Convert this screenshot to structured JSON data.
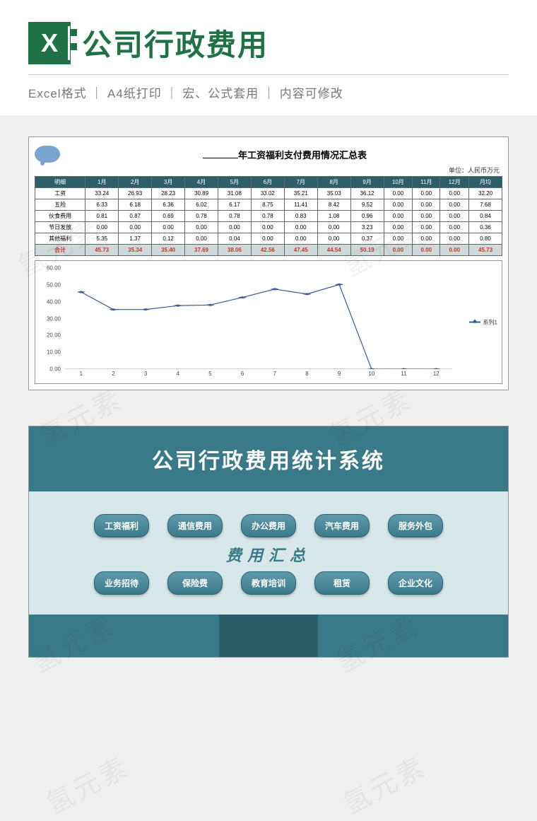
{
  "header": {
    "title": "公司行政费用",
    "subtitle": "Excel格式 ｜ A4纸打印 ｜ 宏、公式套用 ｜ 内容可修改"
  },
  "sheet1": {
    "title_prefix": "",
    "title_core": "年工资福利支付费用情况汇总表",
    "unit": "单位：人民币万元",
    "headers": [
      "明细",
      "1月",
      "2月",
      "3月",
      "4月",
      "5月",
      "6月",
      "7月",
      "8月",
      "9月",
      "10月",
      "11月",
      "12月",
      "月均"
    ],
    "rows": [
      {
        "label": "工资",
        "values": [
          "33.24",
          "26.93",
          "28.23",
          "30.89",
          "31.08",
          "33.02",
          "35.21",
          "35.03",
          "36.12",
          "0.00",
          "0.00",
          "0.00",
          "32.20"
        ]
      },
      {
        "label": "五险",
        "values": [
          "6.33",
          "6.18",
          "6.36",
          "6.02",
          "6.17",
          "8.75",
          "11.41",
          "8.42",
          "9.52",
          "0.00",
          "0.00",
          "0.00",
          "7.68"
        ]
      },
      {
        "label": "伙食费用",
        "values": [
          "0.81",
          "0.87",
          "0.69",
          "0.78",
          "0.78",
          "0.78",
          "0.83",
          "1.08",
          "0.96",
          "0.00",
          "0.00",
          "0.00",
          "0.84"
        ]
      },
      {
        "label": "节日发放",
        "values": [
          "0.00",
          "0.00",
          "0.00",
          "0.00",
          "0.00",
          "0.00",
          "0.00",
          "0.00",
          "3.23",
          "0.00",
          "0.00",
          "0.00",
          "0.36"
        ]
      },
      {
        "label": "其他福利",
        "values": [
          "5.35",
          "1.37",
          "0.12",
          "0.00",
          "0.04",
          "0.00",
          "0.00",
          "0.00",
          "0.37",
          "0.00",
          "0.00",
          "0.00",
          "0.80"
        ]
      }
    ],
    "total": {
      "label": "合计",
      "values": [
        "45.73",
        "35.34",
        "35.40",
        "37.69",
        "38.06",
        "42.56",
        "47.45",
        "44.54",
        "50.19",
        "0.00",
        "0.00",
        "0.00",
        "45.73"
      ]
    }
  },
  "chart_data": {
    "type": "line",
    "title": "",
    "xlabel": "",
    "ylabel": "",
    "xlim": [
      1,
      12
    ],
    "ylim": [
      0,
      60
    ],
    "y_ticks": [
      "0.00",
      "10.00",
      "20.00",
      "30.00",
      "40.00",
      "50.00",
      "60.00"
    ],
    "x_ticks": [
      "1",
      "2",
      "3",
      "4",
      "5",
      "6",
      "7",
      "8",
      "9",
      "10",
      "11",
      "12"
    ],
    "series": [
      {
        "name": "系列1",
        "color": "#3b5b9a",
        "x": [
          1,
          2,
          3,
          4,
          5,
          6,
          7,
          8,
          9,
          10,
          11,
          12
        ],
        "values": [
          45.73,
          35.34,
          35.4,
          37.69,
          38.06,
          42.56,
          47.45,
          44.54,
          50.19,
          0.0,
          0.0,
          0.0
        ]
      }
    ]
  },
  "sheet2": {
    "banner": "公司行政费用统计系统",
    "row1": [
      "工资福利",
      "通信费用",
      "办公费用",
      "汽车费用",
      "服务外包"
    ],
    "summary": "费用汇总",
    "row2": [
      "业务招待",
      "保险费",
      "教育培训",
      "租赁",
      "企业文化"
    ]
  },
  "watermark_text": "氢元素"
}
